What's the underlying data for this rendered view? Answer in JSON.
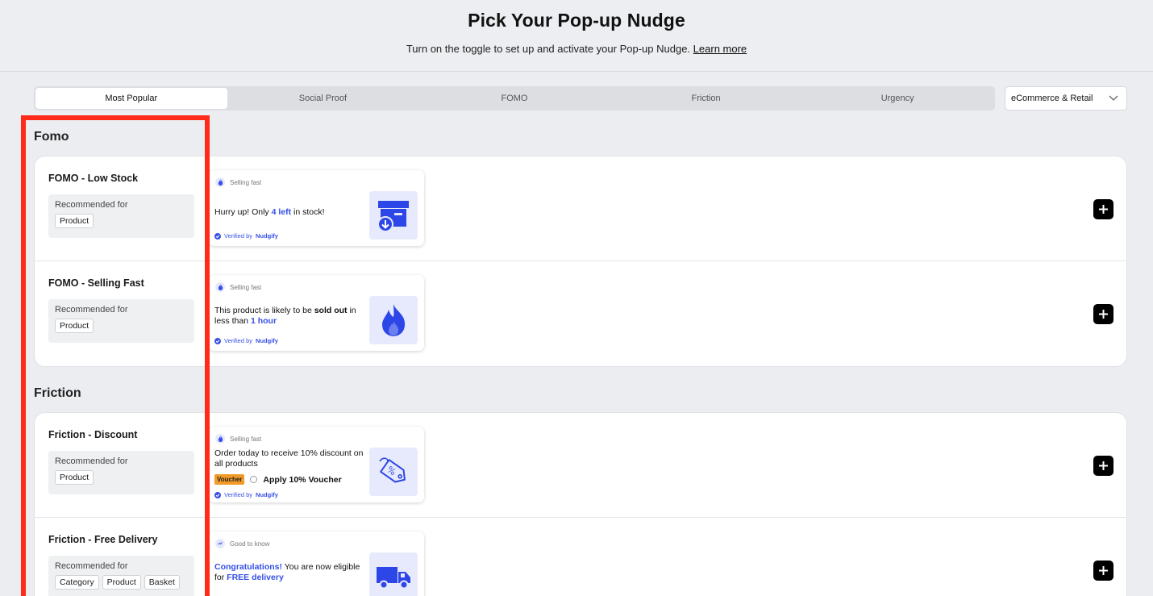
{
  "header": {
    "title": "Pick Your Pop-up Nudge",
    "subtitle": "Turn on the toggle to set up and activate your Pop-up Nudge.",
    "learn_more": "Learn more"
  },
  "tabs": [
    "Most Popular",
    "Social Proof",
    "FOMO",
    "Friction",
    "Urgency"
  ],
  "active_tab": "Most Popular",
  "industry_select": {
    "value": "eCommerce & Retail"
  },
  "sections": [
    {
      "title": "Fomo",
      "rows": [
        {
          "name": "FOMO - Low Stock",
          "recommended_label": "Recommended for",
          "chips": [
            "Product"
          ],
          "preview": {
            "tag": "Selling fast",
            "text_a": "Hurry up! Only ",
            "text_b": "4 left",
            "text_c": " in stock!",
            "verified_prefix": "Verified by ",
            "verified_brand": "Nudgify",
            "icon": "box-arrow-icon"
          }
        },
        {
          "name": "FOMO - Selling Fast",
          "recommended_label": "Recommended for",
          "chips": [
            "Product"
          ],
          "preview": {
            "tag": "Selling fast",
            "text_a": "This product is likely to be ",
            "text_b": "sold out",
            "text_c": " in less than ",
            "text_d": "1 hour",
            "verified_prefix": "Verified by ",
            "verified_brand": "Nudgify",
            "icon": "flame-icon"
          }
        }
      ]
    },
    {
      "title": "Friction",
      "rows": [
        {
          "name": "Friction - Discount",
          "recommended_label": "Recommended for",
          "chips": [
            "Product"
          ],
          "preview": {
            "tag": "Selling fast",
            "text_a": "Order today to receive 10% discount on all products",
            "voucher_tag": "Voucher",
            "voucher_text": "Apply 10% Voucher",
            "verified_prefix": "Verified by ",
            "verified_brand": "Nudgify",
            "icon": "price-tag-icon"
          }
        },
        {
          "name": "Friction - Free Delivery",
          "recommended_label": "Recommended for",
          "chips": [
            "Category",
            "Product",
            "Basket"
          ],
          "preview": {
            "tag": "Good to know",
            "text_a": "Congratulations!",
            "text_b": " You are now eligible for ",
            "text_c": "FREE delivery",
            "icon": "delivery-truck-icon"
          }
        }
      ]
    }
  ],
  "colors": {
    "accent": "#3650e6",
    "highlight": "#ff2a1a",
    "voucher": "#f29a28"
  }
}
